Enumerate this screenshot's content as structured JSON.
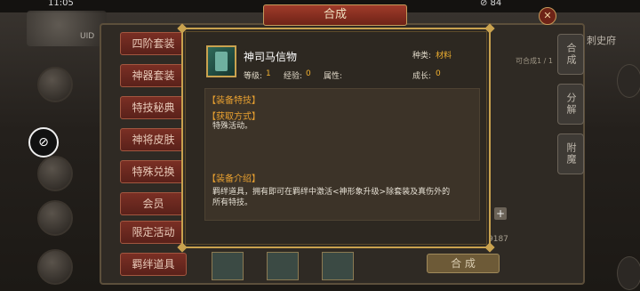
{
  "status_bar": {
    "time": "11:05",
    "right": "⊘ 84"
  },
  "left_id": "UID",
  "window": {
    "title": "合成",
    "close": "✕"
  },
  "menu": [
    "四阶套装",
    "神器套装",
    "特技秘典",
    "神将皮肤",
    "特殊兑换",
    "会员",
    "限定活动",
    "羁绊道具"
  ],
  "right_tabs": [
    "合成",
    "分解",
    "附魔"
  ],
  "right_label": "刺史府",
  "craft_count": "可合成1 / 1",
  "coin_count": "9187",
  "craft_button": "合 成",
  "plus": "+",
  "popup": {
    "item_name": "神司马信物",
    "type_label": "种类:",
    "type_value": "材料",
    "level_label": "等级:",
    "level_value": "1",
    "exp_label": "经验:",
    "exp_value": "0",
    "attr_label": "属性:",
    "growth_label": "成长:",
    "growth_value": "0",
    "features_title": "【装备特技】",
    "obtain_title": "【获取方式】",
    "obtain_text": "特殊活动。",
    "intro_title": "【装备介绍】",
    "intro_text_1": "羁绊道具，拥有即可在羁绊中激活<神形象升级>除套装及真伤外的",
    "intro_text_2": "所有特技。"
  },
  "colors": {
    "accent_gold": "#c9a24f",
    "orange_text": "#e8a030",
    "value_orange": "#f0b030",
    "menu_red": "#7a2f24"
  }
}
